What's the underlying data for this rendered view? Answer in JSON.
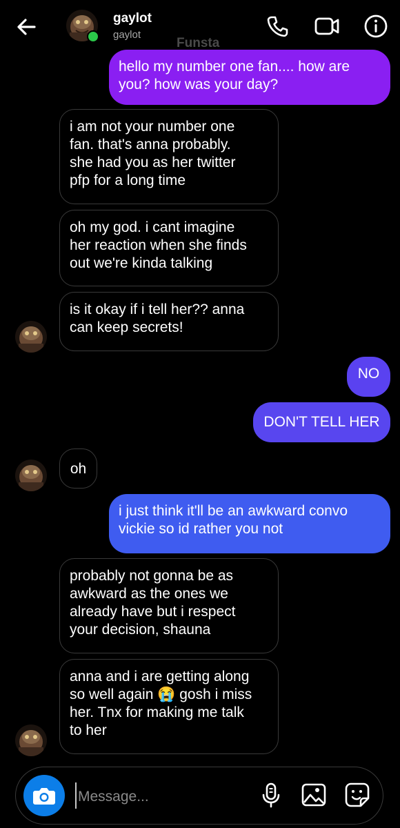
{
  "header": {
    "name": "gaylot",
    "handle": "gaylot",
    "watermark": "Funsta"
  },
  "messages": [
    {
      "from": "me",
      "text": "hello my number one fan.... how are\nyou? how was your day?"
    },
    {
      "from": "them",
      "text": "i am not your number one\nfan. that's anna probably.\nshe had you as her twitter\npfp for a long time"
    },
    {
      "from": "them",
      "text": "oh my god. i cant imagine\nher reaction when she finds\nout we're kinda talking"
    },
    {
      "from": "them",
      "text": "is it okay if i tell her?? anna\ncan keep secrets!"
    },
    {
      "from": "me",
      "text": "NO"
    },
    {
      "from": "me",
      "text": "DON'T TELL HER"
    },
    {
      "from": "them",
      "text": "oh"
    },
    {
      "from": "me",
      "text": "i just think it'll be an awkward convo\nvickie so id rather you not"
    },
    {
      "from": "them",
      "text": "probably not gonna be as\nawkward as the ones we\nalready have but i respect\nyour decision, shauna"
    },
    {
      "from": "them",
      "text_before": "anna and i are getting along\nso well again ",
      "emoji": "😭",
      "text_after": " gosh i miss\nher. Tnx for making me talk\nto her"
    }
  ],
  "composer": {
    "placeholder": "Message..."
  },
  "colors": {
    "outgoing_purple": "#8a1ff2",
    "outgoing_blue": "#4a4ff0",
    "camera_button": "#0c7ee8",
    "online": "#2bc84a"
  },
  "icons": [
    "back-arrow-icon",
    "phone-icon",
    "video-icon",
    "info-icon",
    "camera-icon",
    "microphone-icon",
    "gallery-icon",
    "sticker-icon"
  ]
}
